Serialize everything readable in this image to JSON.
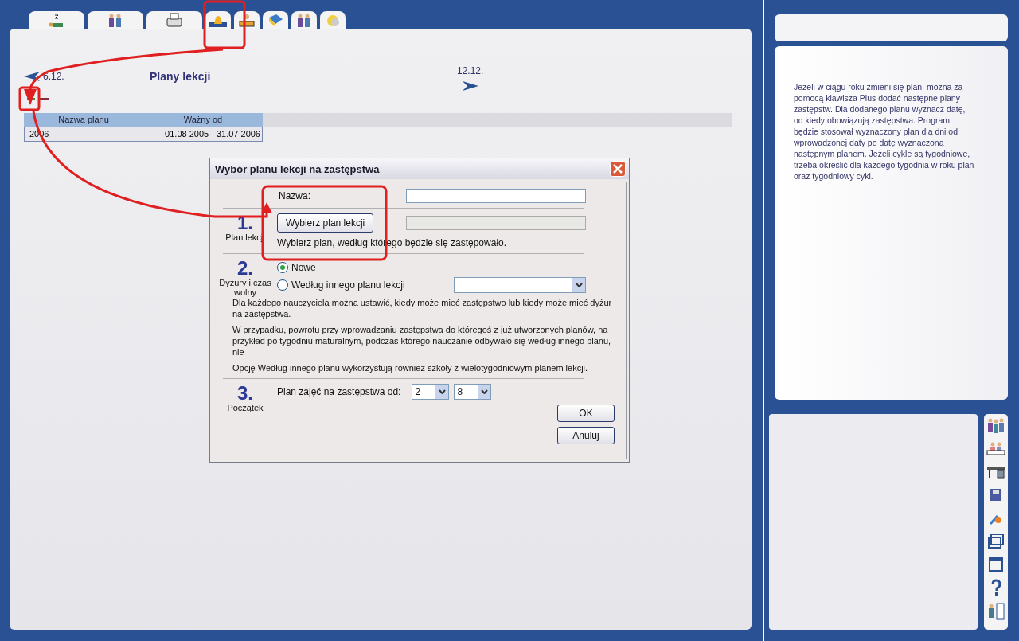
{
  "header": {
    "prev_date": "6.12.",
    "title": "Plany lekcji",
    "next_date": "12.12."
  },
  "table": {
    "columns": [
      "Nazwa planu",
      "Ważny od"
    ],
    "rows": [
      [
        "2006",
        "01.08 2005 - 31.07 2006"
      ]
    ]
  },
  "dialog": {
    "title": "Wybór planu lekcji na zastępstwa",
    "name_label": "Nazwa:",
    "step1": {
      "number": "1.",
      "label": "Plan lekcji",
      "button": "Wybierz plan lekcji",
      "hint": "Wybierz plan, według którego będzie się zastępowało."
    },
    "step2": {
      "number": "2.",
      "label": "Dyżury i czas wolny",
      "options": [
        {
          "label": "Nowe",
          "selected": true
        },
        {
          "label": "Według innego planu lekcji",
          "selected": false
        }
      ],
      "paragraphs": [
        "Dla każdego nauczyciela można ustawić, kiedy może mieć zastępstwo lub kiedy może mieć dyżur na zastępstwa.",
        "W przypadku, powrotu przy wprowadzaniu zastępstwa do któregoś z już utworzonych planów, na przykład po tygodniu maturalnym, podczas którego nauczanie odbywało się według innego planu, nie",
        "Opcję Według innego planu wykorzystują również szkoły z wielotygodniowym planem lekcji."
      ]
    },
    "step3": {
      "number": "3.",
      "label": "Początek",
      "field_label": "Plan zajęć na zastępstwa od:",
      "values": [
        "2",
        "8"
      ]
    },
    "buttons": [
      "OK",
      "Anuluj"
    ]
  },
  "help_text": "Jeżeli w ciągu roku zmieni się plan, można za pomocą klawisza Plus dodać następne plany zastępstw. Dla dodanego planu wyznacz datę, od kiedy obowiązują zastępstwa. Program będzie stosował wyznaczony plan dla dni od wprowadzonej daty po datę wyznaczoną następnym planem. Jeżeli cykle są tygodniowe, trzeba określić dla każdego tygodnia w roku plan oraz tygodniowy cykl."
}
